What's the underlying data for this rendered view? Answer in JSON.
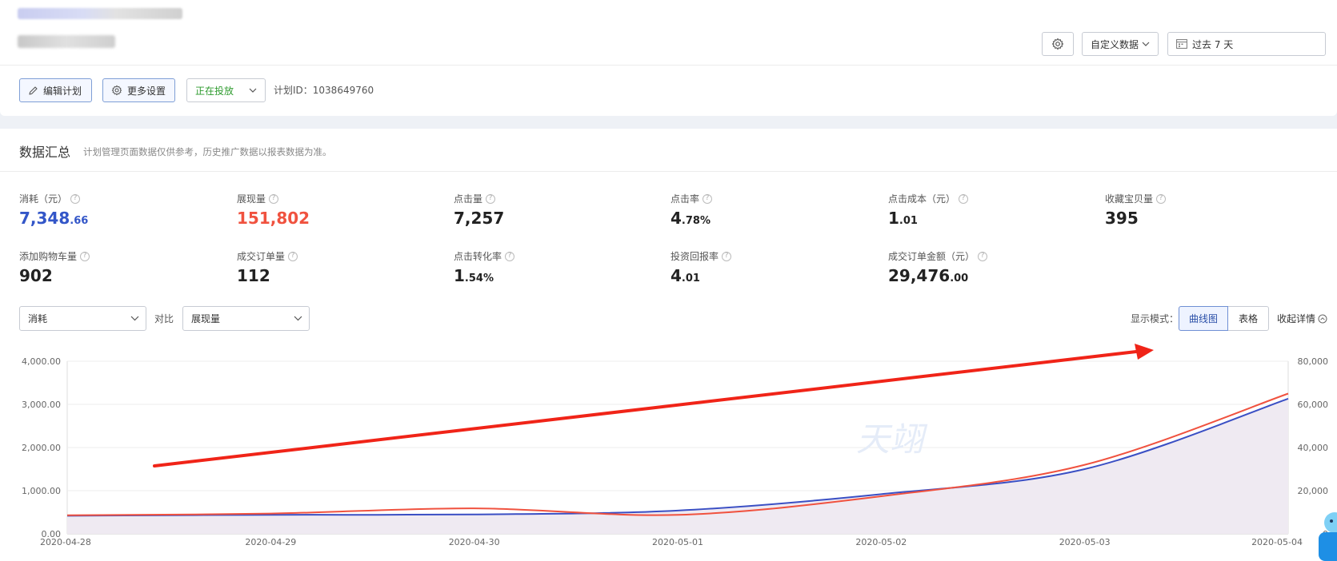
{
  "header": {
    "settings_icon": "gear-icon",
    "custom_data_label": "自定义数据",
    "date_range_label": "过去 7 天",
    "calendar_icon": "calendar-icon"
  },
  "toolbar": {
    "edit_plan_label": "编辑计划",
    "more_settings_label": "更多设置",
    "status_select_value": "正在投放",
    "plan_id_text": "计划ID：1038649760"
  },
  "summary": {
    "title": "数据汇总",
    "note": "计划管理页面数据仅供参考，历史推广数据以报表数据为准。"
  },
  "metrics": [
    {
      "label": "消耗（元）",
      "int": "7,348",
      "dec": ".66",
      "color": "#3356c8"
    },
    {
      "label": "展现量",
      "int": "151,802",
      "dec": "",
      "color": "#f0523f"
    },
    {
      "label": "点击量",
      "int": "7,257",
      "dec": ""
    },
    {
      "label": "点击率",
      "int": "4",
      "dec": ".78%"
    },
    {
      "label": "点击成本（元）",
      "int": "1",
      "dec": ".01"
    },
    {
      "label": "收藏宝贝量",
      "int": "395",
      "dec": ""
    },
    {
      "label": "添加购物车量",
      "int": "902",
      "dec": ""
    },
    {
      "label": "成交订单量",
      "int": "112",
      "dec": ""
    },
    {
      "label": "点击转化率",
      "int": "1",
      "dec": ".54%"
    },
    {
      "label": "投资回报率",
      "int": "4",
      "dec": ".01"
    },
    {
      "label": "成交订单金额（元）",
      "int": "29,476",
      "dec": ".00"
    }
  ],
  "controls": {
    "metric_a": "消耗",
    "compare_label": "对比",
    "metric_b": "展现量",
    "display_mode_label": "显示模式：",
    "mode_curve": "曲线图",
    "mode_table": "表格",
    "collapse_label": "收起详情"
  },
  "chart_data": {
    "type": "line",
    "x": [
      "2020-04-28",
      "2020-04-29",
      "2020-04-30",
      "2020-05-01",
      "2020-05-02",
      "2020-05-03",
      "2020-05-04"
    ],
    "left_axis": {
      "ticks": [
        "0.00",
        "1,000.00",
        "2,000.00",
        "3,000.00",
        "4,000.00"
      ],
      "ylim": [
        0,
        4000
      ]
    },
    "right_axis": {
      "ticks": [
        "0",
        "20,000",
        "40,000",
        "60,000",
        "80,000"
      ],
      "ylim": [
        0,
        80000
      ]
    },
    "series": [
      {
        "name": "消耗",
        "axis": "left",
        "color": "#3a4fc4",
        "values": [
          420,
          440,
          450,
          540,
          920,
          1500,
          3130
        ]
      },
      {
        "name": "展现量",
        "axis": "right",
        "color": "#f0523f",
        "values": [
          8600,
          9400,
          11800,
          8800,
          17400,
          32000,
          65000
        ]
      }
    ],
    "grid": true,
    "annotation": {
      "type": "arrow",
      "color": "#f02418"
    },
    "watermark": "天翊"
  }
}
